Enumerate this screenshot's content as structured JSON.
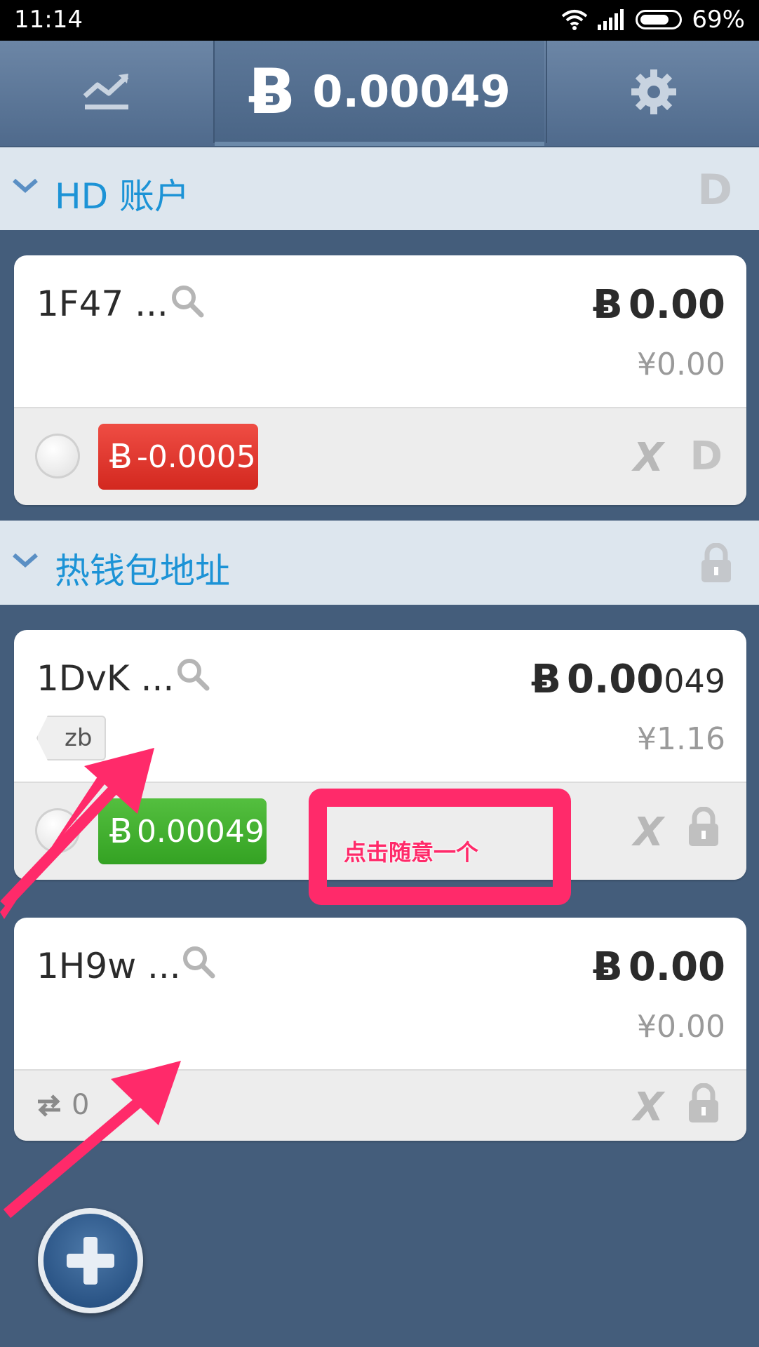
{
  "status_bar": {
    "time": "11:14",
    "battery_percent": "69%"
  },
  "top_bar": {
    "balance_symbol": "Ƀ",
    "balance": "0.00049"
  },
  "hd_section": {
    "title": "HD 账户"
  },
  "hot_section": {
    "title": "热钱包地址"
  },
  "cards": [
    {
      "address": "1F47 ...",
      "btc_symbol": "Ƀ",
      "btc_main": "0.00",
      "btc_small": "",
      "cny": "¥0.00",
      "pill_text": "-0.0005",
      "pill_color": "#e0362d"
    },
    {
      "address": "1DvK ...",
      "tag": "zb",
      "btc_symbol": "Ƀ",
      "btc_main": "0.00",
      "btc_small": "049",
      "cny": "¥1.16",
      "pill_text": "0.00049",
      "pill_color": "#3fae2d"
    },
    {
      "address": "1H9w ...",
      "btc_symbol": "Ƀ",
      "btc_main": "0.00",
      "btc_small": "",
      "cny": "¥0.00",
      "tx_count": "0"
    }
  ],
  "annotation": {
    "text": "点击随意一个",
    "color": "#ff2a6a"
  },
  "icons": {
    "chart": "chart-trend-icon",
    "settings": "gear-icon",
    "d_badge": "D",
    "lock": "lock-icon",
    "search": "search-icon",
    "x": "X",
    "plus": "plus-icon"
  }
}
